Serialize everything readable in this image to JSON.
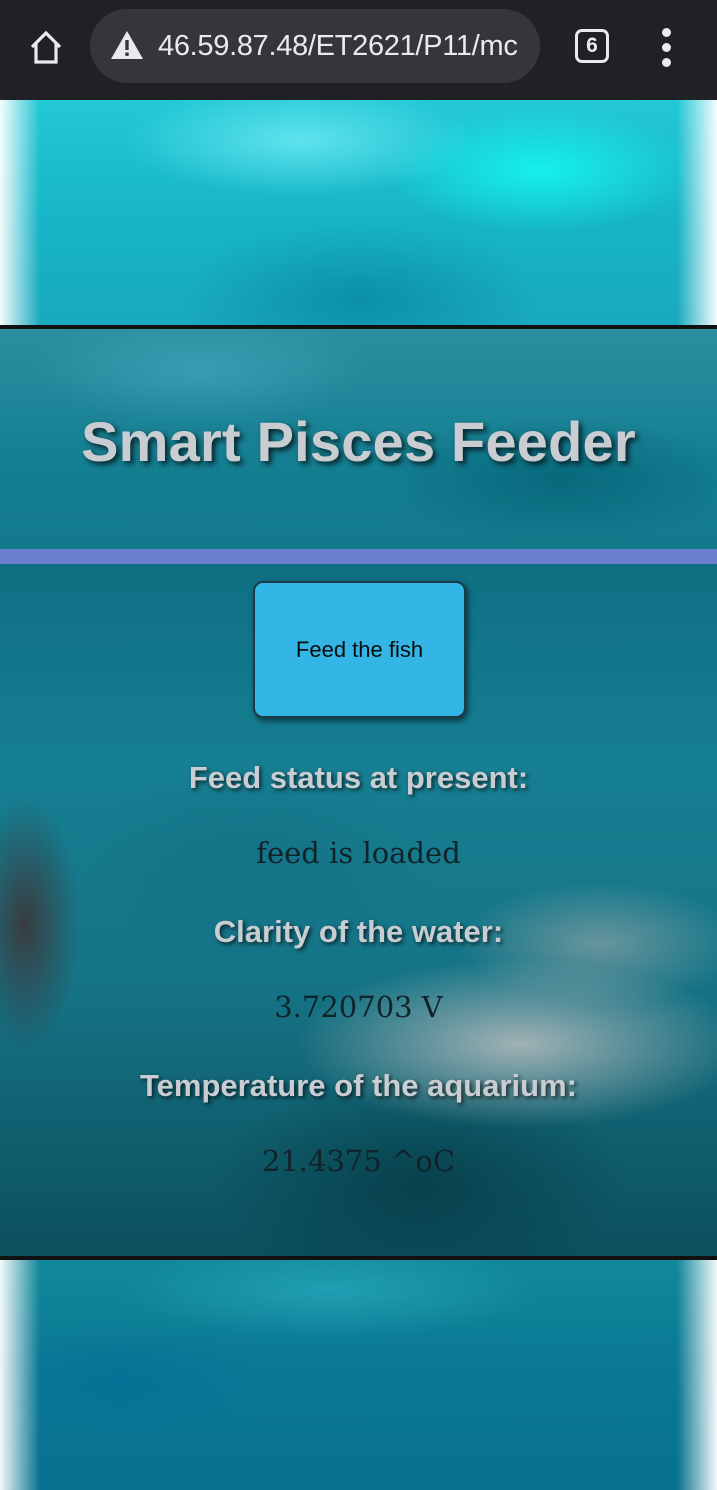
{
  "browser": {
    "url": "46.59.87.48/ET2621/P11/mc",
    "tab_count": "6",
    "icons": {
      "home": "home-icon",
      "security": "warning-icon",
      "menu": "more-vert-icon"
    }
  },
  "header": {
    "title": "Smart Pisces Feeder"
  },
  "main": {
    "feed_button_label": "Feed the fish",
    "feed_status_label": "Feed status at present:",
    "feed_status_value": "feed is loaded",
    "clarity_label": "Clarity of the water:",
    "clarity_value": "3.720703 V",
    "temperature_label": "Temperature of the aquarium:",
    "temperature_value": "21.4375 ^oC"
  },
  "colors": {
    "browser_bar": "#202124",
    "accent_strip": "#6a7fce",
    "button": "#33b5e5",
    "title_text": "#c9cdd2"
  }
}
